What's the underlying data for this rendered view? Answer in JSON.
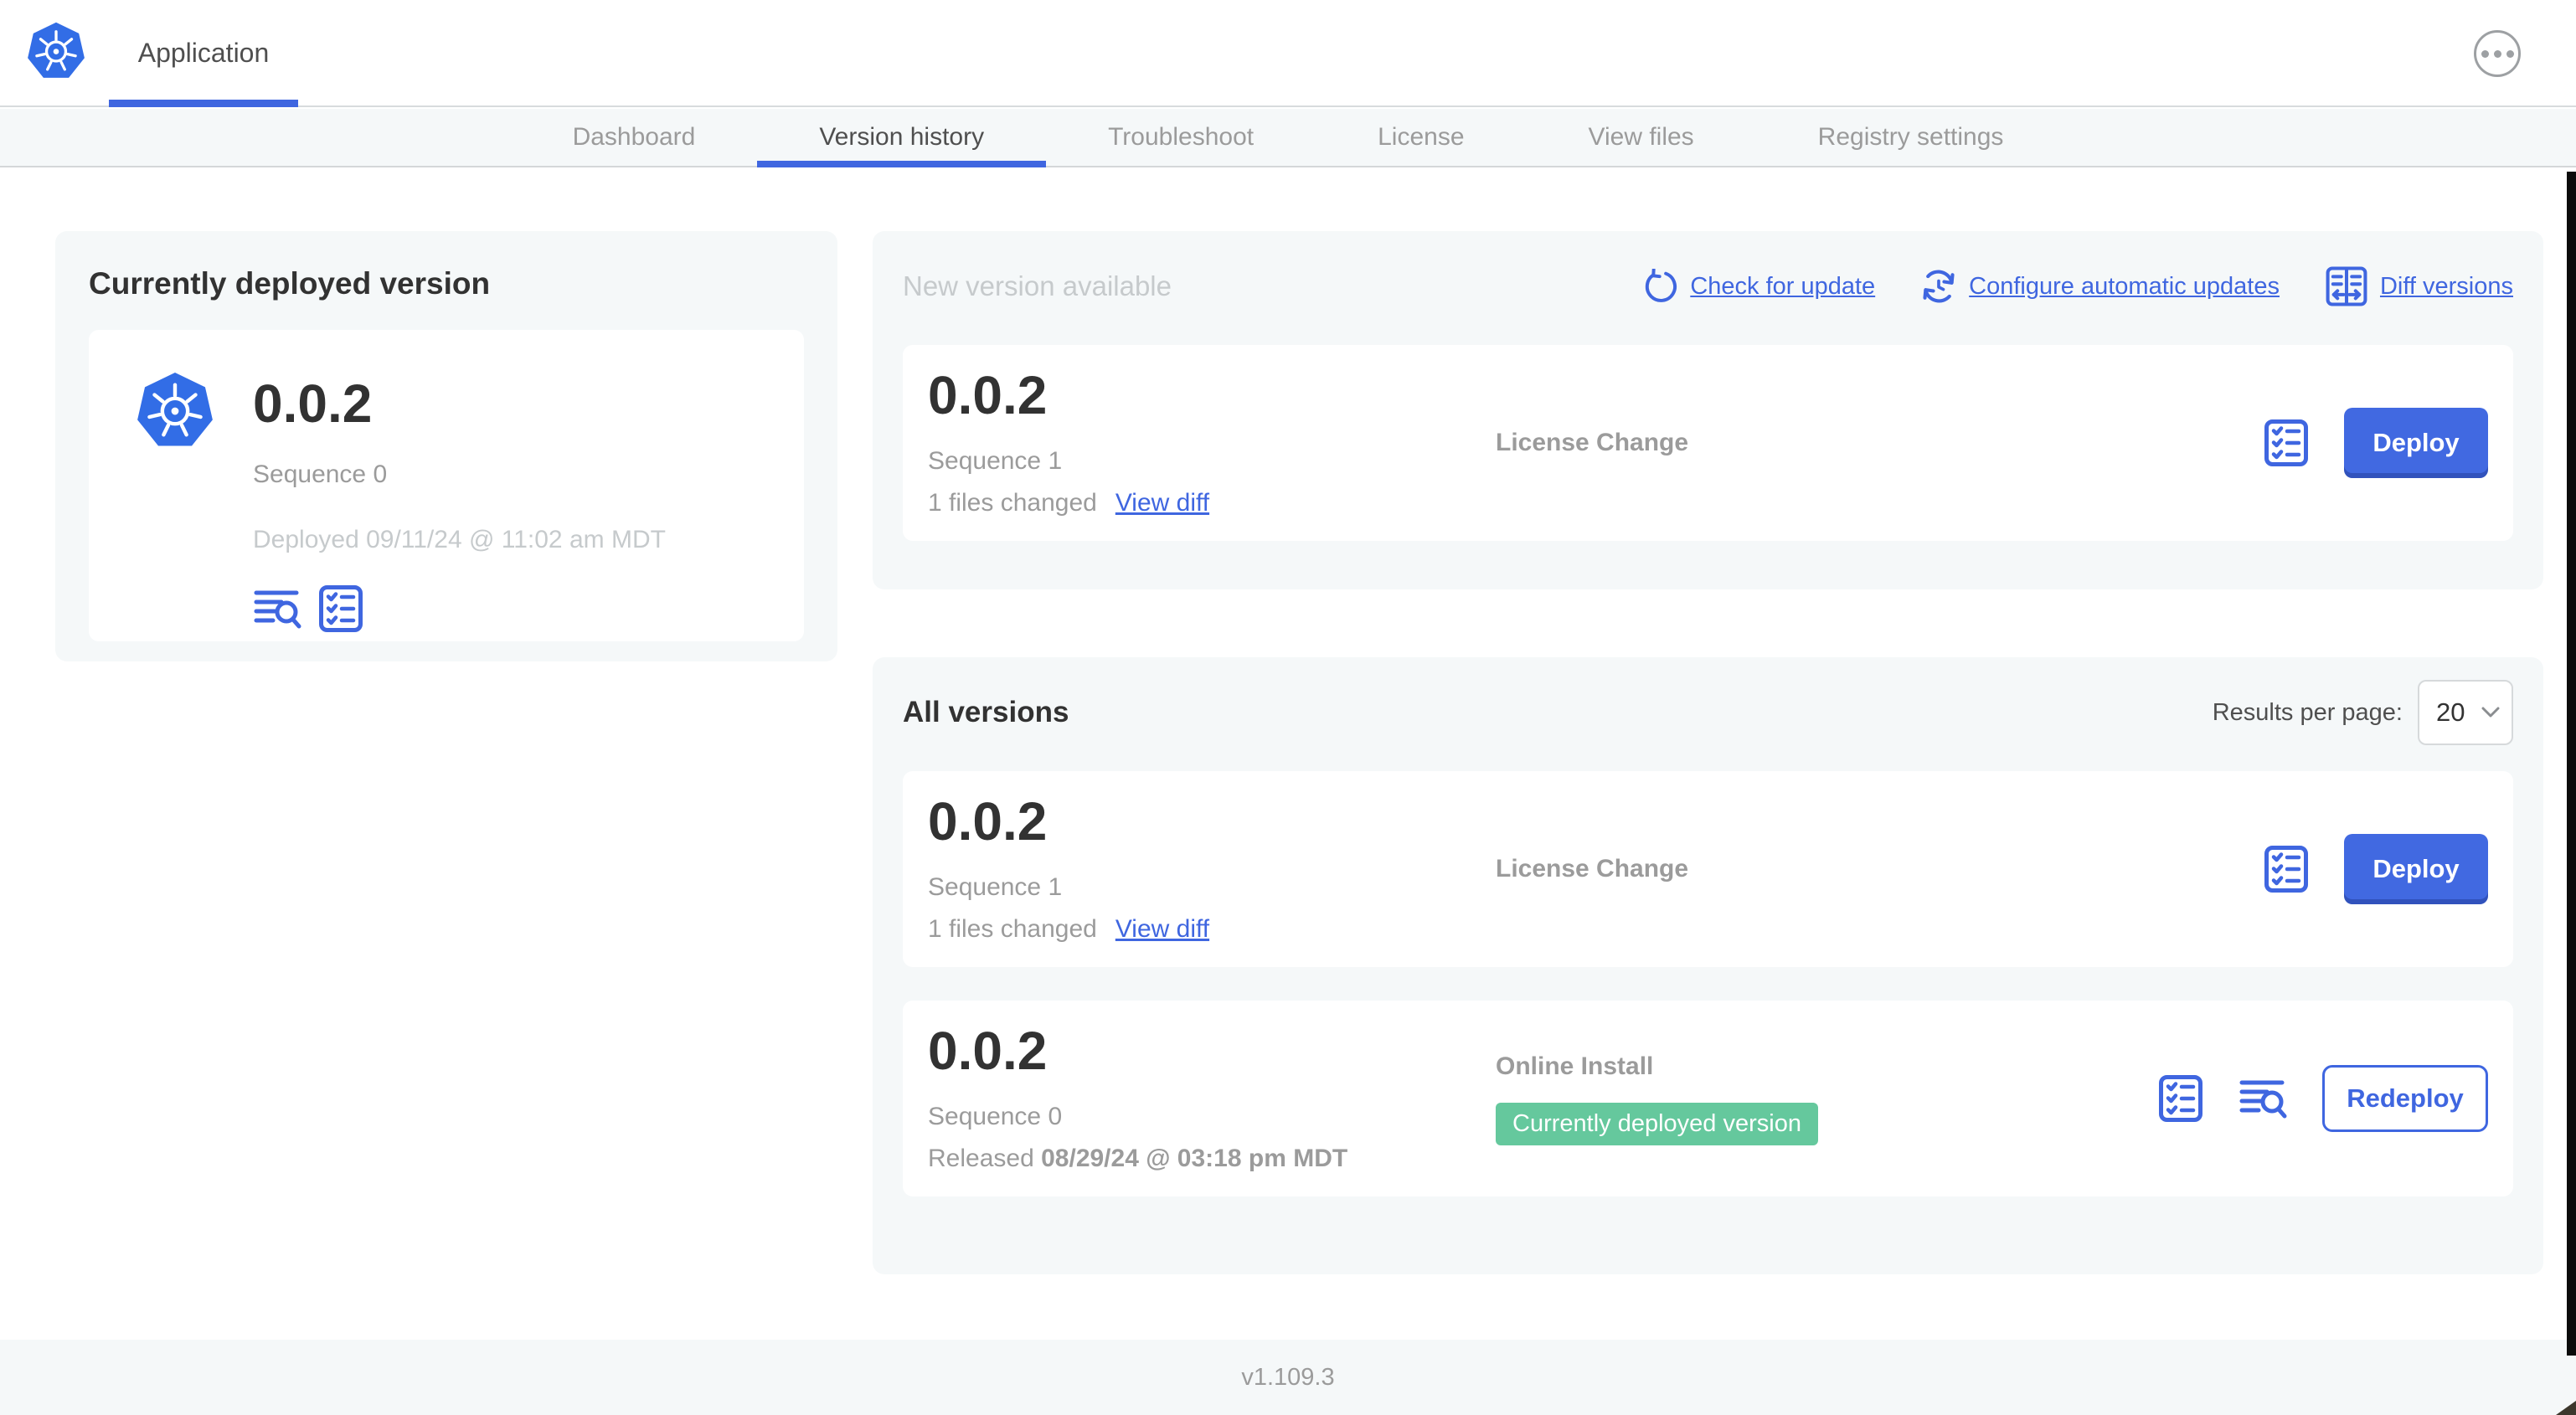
{
  "header": {
    "app_tab": "Application"
  },
  "nav": {
    "tabs": [
      {
        "label": "Dashboard"
      },
      {
        "label": "Version history"
      },
      {
        "label": "Troubleshoot"
      },
      {
        "label": "License"
      },
      {
        "label": "View files"
      },
      {
        "label": "Registry settings"
      }
    ]
  },
  "current_version": {
    "title": "Currently deployed version",
    "version": "0.0.2",
    "sequence": "Sequence 0",
    "deployed": "Deployed 09/11/24 @ 11:02 am MDT"
  },
  "new_version": {
    "title": "New version available",
    "check_for_update": "Check for update",
    "configure_automatic_updates": "Configure automatic updates",
    "diff_versions": "Diff versions",
    "row": {
      "version": "0.0.2",
      "sequence": "Sequence 1",
      "files_changed": "1 files changed",
      "view_diff": "View diff",
      "release_type": "License Change",
      "action": "Deploy"
    }
  },
  "all_versions": {
    "title": "All versions",
    "results_per_page_label": "Results per page:",
    "results_per_page_value": "20",
    "rows": [
      {
        "version": "0.0.2",
        "sequence": "Sequence 1",
        "files_changed": "1 files changed",
        "view_diff": "View diff",
        "release_type": "License Change",
        "action": "Deploy"
      },
      {
        "version": "0.0.2",
        "sequence": "Sequence 0",
        "released_label": "Released",
        "released_date": "08/29/24 @ 03:18 pm MDT",
        "release_type": "Online Install",
        "badge": "Currently deployed version",
        "action": "Redeploy"
      }
    ]
  },
  "footer": {
    "app_version": "v1.109.3"
  },
  "icons": {
    "app_logo": "kubernetes-logo",
    "more_menu": "ellipsis-icon",
    "check_update": "refresh-icon",
    "auto_updates": "scheduled-refresh-icon",
    "diff": "diff-versions-icon",
    "logs": "version-logs-icon",
    "checks": "preflight-checklist-icon",
    "select_arrow": "chevron-down-icon"
  },
  "colors": {
    "accent_blue": "#3f66e0",
    "button_blue": "#4169e1",
    "badge_green": "#65c89d",
    "panel_bg": "#f5f8f9",
    "text_dark": "#323232",
    "text_gray": "#9b9b9b",
    "text_light_gray": "#c6cacc"
  }
}
